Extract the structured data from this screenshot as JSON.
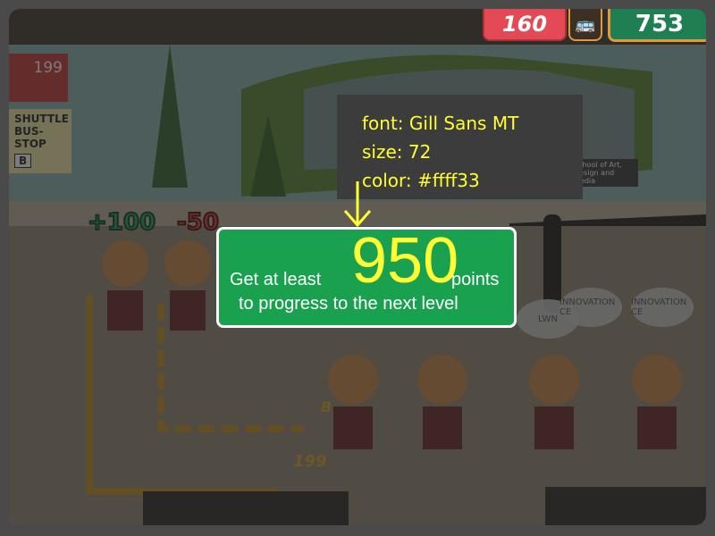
{
  "hud": {
    "deduct_value": "160",
    "bus_icon": "bus-icon",
    "score": "753"
  },
  "scene": {
    "route_number": "199",
    "bus_stop_line1": "SHUTTLE",
    "bus_stop_line2": "BUS-STOP",
    "bus_stop_letter": "B",
    "plus_points": "+100",
    "minus_points": "-50",
    "floor_letter": "B",
    "floor_number": "199",
    "bubble1": "LWN",
    "bubble2": "INNOVATION CE",
    "bubble3": "INNOVATION CE",
    "building_sign": "School of Art, Design and Media"
  },
  "annotation": {
    "line1": "font: Gill Sans MT",
    "line2": "size: 72",
    "line3": "color: #ffff33"
  },
  "goal": {
    "pre_text": "Get at least",
    "points_required": "950",
    "post_text": "points",
    "line2": "to progress to the next level",
    "accent_color": "#ffff33",
    "panel_color": "#1aa150"
  }
}
